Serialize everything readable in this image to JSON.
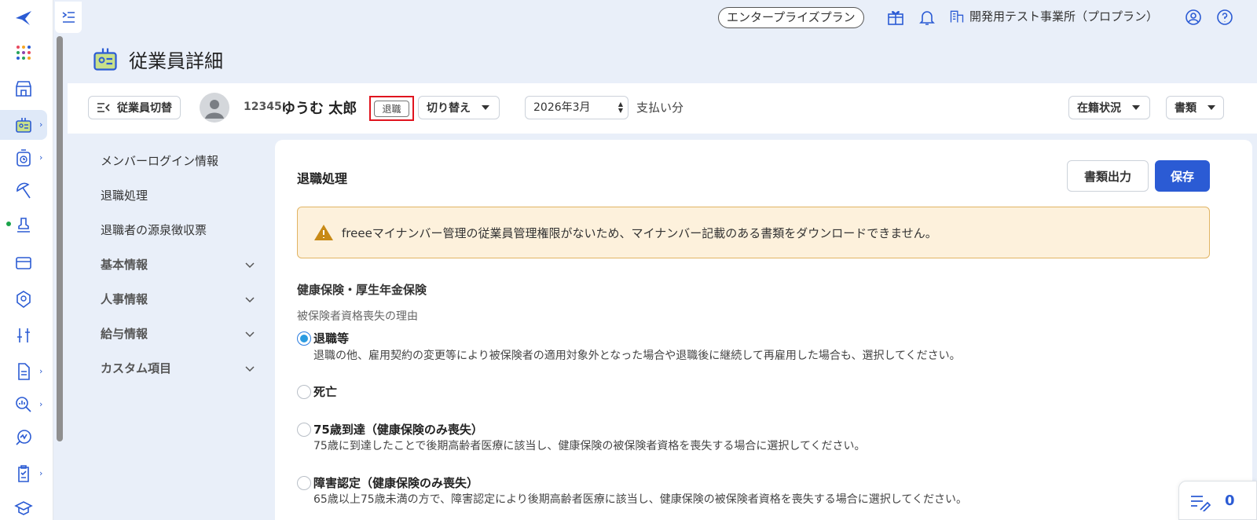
{
  "topbar": {
    "plan": "エンタープライズプラン",
    "office": "開発用テスト事業所（プロプラン）"
  },
  "page": {
    "title": "従業員詳細"
  },
  "employee_bar": {
    "switch_label": "従業員切替",
    "employee_no": "12345",
    "employee_name": "ゆうむ 太郎",
    "status_badge": "退職",
    "toggle_label": "切り替え",
    "month_value": "2026年3月",
    "pay_label": "支払い分",
    "enroll_label": "在籍状況",
    "docs_label": "書類"
  },
  "section_nav": {
    "links": [
      "メンバーログイン情報",
      "退職処理",
      "退職者の源泉徴収票"
    ],
    "groups": [
      "基本情報",
      "人事情報",
      "給与情報",
      "カスタム項目"
    ]
  },
  "card": {
    "title": "退職処理",
    "docs_button": "書類出力",
    "save_button": "保存",
    "alert": "freeeマイナンバー管理の従業員管理権限がないため、マイナンバー記載のある書類をダウンロードできません。",
    "section_heading": "健康保険・厚生年金保険",
    "field_label": "被保険者資格喪失の理由",
    "options": [
      {
        "label": "退職等",
        "desc": "退職の他、雇用契約の変更等により被保険者の適用対象外となった場合や退職後に継続して再雇用した場合も、選択してください。",
        "checked": true
      },
      {
        "label": "死亡",
        "desc": "",
        "checked": false
      },
      {
        "label": "75歳到達（健康保険のみ喪失）",
        "desc": "75歳に到達したことで後期高齢者医療に該当し、健康保険の被保険者資格を喪失する場合に選択してください。",
        "checked": false
      },
      {
        "label": "障害認定（健康保険のみ喪失）",
        "desc": "65歳以上75歳未満の方で、障害認定により後期高齢者医療に該当し、健康保険の被保険者資格を喪失する場合に選択してください。",
        "checked": false
      }
    ]
  },
  "corner_widget": {
    "count": "0"
  },
  "colors": {
    "primary": "#2b5bd4",
    "highlight": "#e0141e",
    "alert_bg": "#fdf1dc"
  }
}
